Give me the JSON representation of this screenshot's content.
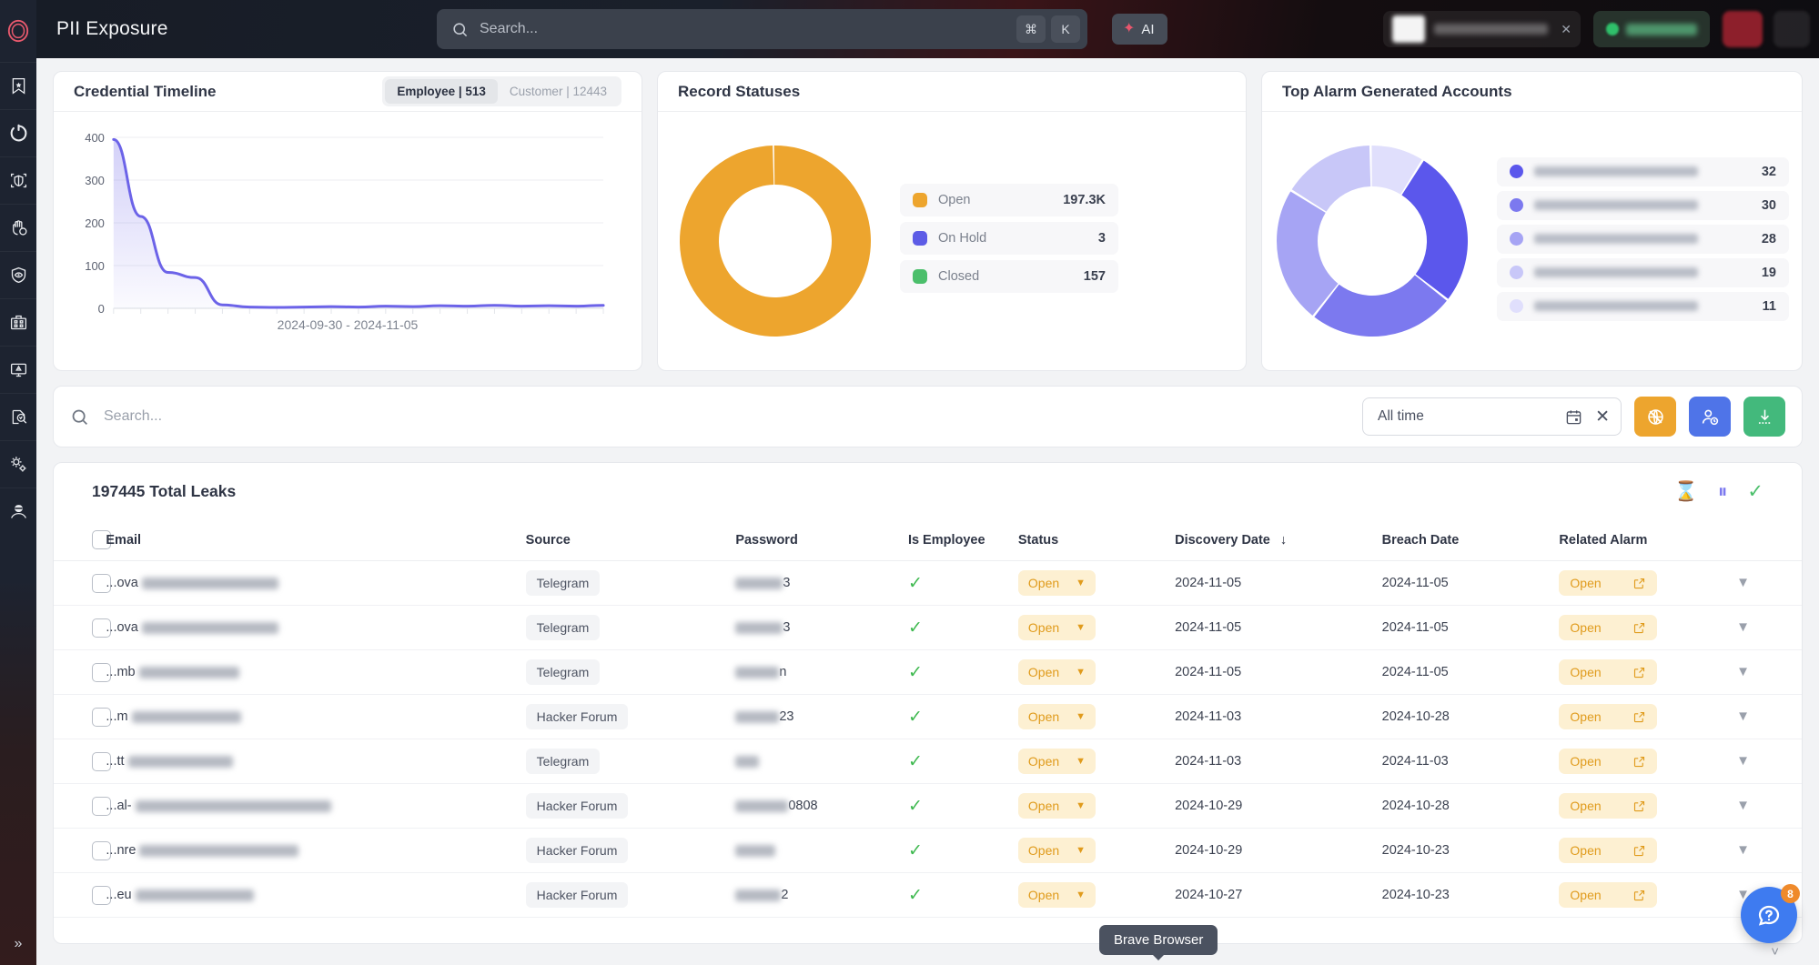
{
  "app": {
    "title": "PII Exposure",
    "logo_icon": "target-ring-icon"
  },
  "header": {
    "search": {
      "placeholder": "Search...",
      "value": "",
      "icon": "search-icon"
    },
    "shortcut_keys": [
      "⌘",
      "K"
    ],
    "ai_button": {
      "label": "AI",
      "icon": "sparkle-icon"
    },
    "account_chip": {
      "icon": "avatar-icon",
      "close_icon": "close-icon"
    },
    "status_pill": {
      "icon": "status-dot-icon"
    },
    "alert_button": {
      "icon": "alert-icon"
    },
    "menu_button": {
      "icon": "grid-icon"
    }
  },
  "sidebar": {
    "collapse_label": "»",
    "items": [
      {
        "name": "sidebar-item-bookmarks",
        "icon": "bookmark-star-icon"
      },
      {
        "name": "sidebar-item-refresh",
        "icon": "refresh-circle-icon"
      },
      {
        "name": "sidebar-item-shield-scan",
        "icon": "shield-scan-icon"
      },
      {
        "name": "sidebar-item-protection",
        "icon": "hand-shield-icon"
      },
      {
        "name": "sidebar-item-monitoring",
        "icon": "shield-eye-icon"
      },
      {
        "name": "sidebar-item-organization",
        "icon": "building-icon"
      },
      {
        "name": "sidebar-item-incidents",
        "icon": "monitor-warning-icon"
      },
      {
        "name": "sidebar-item-investigation",
        "icon": "document-search-icon"
      },
      {
        "name": "sidebar-item-settings",
        "icon": "gears-icon"
      },
      {
        "name": "sidebar-item-threat-actor",
        "icon": "hacker-icon"
      }
    ]
  },
  "cards": {
    "credential_timeline": {
      "title": "Credential Timeline",
      "tabs": [
        {
          "label": "Employee | 513",
          "active": true
        },
        {
          "label": "Customer | 12443",
          "active": false
        }
      ],
      "caption": "2024-09-30 - 2024-11-05"
    },
    "record_statuses": {
      "title": "Record Statuses",
      "legend": [
        {
          "label": "Open",
          "value": "197.3K",
          "color": "#eda52e"
        },
        {
          "label": "On Hold",
          "value": "3",
          "color": "#5d5ce6"
        },
        {
          "label": "Closed",
          "value": "157",
          "color": "#4bbf6b"
        }
      ]
    },
    "top_alarm_accounts": {
      "title": "Top Alarm Generated Accounts",
      "rows": [
        {
          "value": "32",
          "color": "#5b57ec"
        },
        {
          "value": "30",
          "color": "#7c79ef"
        },
        {
          "value": "28",
          "color": "#a6a4f4"
        },
        {
          "value": "19",
          "color": "#c8c7f8"
        },
        {
          "value": "11",
          "color": "#e0dffc"
        }
      ]
    }
  },
  "chart_data": [
    {
      "type": "area",
      "title": "Credential Timeline",
      "xlabel": "",
      "ylabel": "",
      "ylim": [
        0,
        400
      ],
      "yticks": [
        0,
        100,
        200,
        300,
        400
      ],
      "grid": true,
      "legend": "none",
      "x": [
        "2024-09-30",
        "2024-10-02",
        "2024-10-04",
        "2024-10-06",
        "2024-10-08",
        "2024-10-10",
        "2024-10-12",
        "2024-10-14",
        "2024-10-16",
        "2024-10-18",
        "2024-10-20",
        "2024-10-22",
        "2024-10-24",
        "2024-10-26",
        "2024-10-28",
        "2024-10-30",
        "2024-11-01",
        "2024-11-03",
        "2024-11-05"
      ],
      "series": [
        {
          "name": "Employee",
          "color": "#6c63e8",
          "values": [
            395,
            215,
            84,
            72,
            8,
            3,
            2,
            3,
            4,
            3,
            5,
            4,
            6,
            5,
            7,
            5,
            6,
            5,
            7
          ]
        }
      ],
      "caption": "2024-09-30 - 2024-11-05"
    },
    {
      "type": "pie",
      "title": "Record Statuses",
      "donut": true,
      "labels": [
        "Open",
        "On Hold",
        "Closed"
      ],
      "values": [
        197300,
        3,
        157
      ],
      "display_values": [
        "197.3K",
        "3",
        "157"
      ],
      "colors": [
        "#eda52e",
        "#5d5ce6",
        "#4bbf6b"
      ],
      "legend": "right"
    },
    {
      "type": "pie",
      "title": "Top Alarm Generated Accounts",
      "donut": true,
      "labels": [
        "account-1",
        "account-2",
        "account-3",
        "account-4",
        "account-5"
      ],
      "values": [
        32,
        30,
        28,
        19,
        11
      ],
      "colors": [
        "#5b57ec",
        "#7c79ef",
        "#a6a4f4",
        "#c8c7f8",
        "#e0dffc"
      ],
      "legend": "right"
    }
  ],
  "filterbar": {
    "search": {
      "placeholder": "Search...",
      "value": "",
      "icon": "search-icon"
    },
    "daterange": {
      "value": "All time",
      "calendar_icon": "calendar-icon",
      "clear_icon": "close-icon"
    },
    "buttons": [
      {
        "name": "globe-off-button",
        "icon": "globe-off-icon",
        "color": "#eda52e"
      },
      {
        "name": "assign-user-button",
        "icon": "user-clock-icon",
        "color": "#4f74e8"
      },
      {
        "name": "export-button",
        "icon": "download-icon",
        "color": "#43b97c"
      }
    ]
  },
  "table": {
    "total_label": "197445 Total Leaks",
    "actions": [
      {
        "name": "pending-filter",
        "icon": "hourglass-icon",
        "glyph": "⌛",
        "color": "#eda52e"
      },
      {
        "name": "onhold-filter",
        "icon": "pause-icon",
        "glyph": "⏸",
        "color": "#7c79ef"
      },
      {
        "name": "closed-filter",
        "icon": "check-icon",
        "glyph": "✓",
        "color": "#4bbf6b"
      }
    ],
    "columns": [
      "Email",
      "Source",
      "Password",
      "Is Employee",
      "Status",
      "Discovery Date",
      "Breach Date",
      "Related Alarm"
    ],
    "sorted_column": "Discovery Date",
    "sort_icon": "↓",
    "rows": [
      {
        "email_visible": "...ova",
        "email_blur_w": 150,
        "source": "Telegram",
        "pw_blur_w": 52,
        "pw_visible": "3",
        "is_employee": "✓",
        "status": "Open",
        "discovery": "2024-11-05",
        "breach": "2024-11-05",
        "alarm": "Open"
      },
      {
        "email_visible": "...ova",
        "email_blur_w": 150,
        "source": "Telegram",
        "pw_blur_w": 52,
        "pw_visible": "3",
        "is_employee": "✓",
        "status": "Open",
        "discovery": "2024-11-05",
        "breach": "2024-11-05",
        "alarm": "Open"
      },
      {
        "email_visible": "...mb",
        "email_blur_w": 110,
        "source": "Telegram",
        "pw_blur_w": 48,
        "pw_visible": "n",
        "is_employee": "✓",
        "status": "Open",
        "discovery": "2024-11-05",
        "breach": "2024-11-05",
        "alarm": "Open"
      },
      {
        "email_visible": "...m",
        "email_blur_w": 120,
        "source": "Hacker Forum",
        "pw_blur_w": 48,
        "pw_visible": "23",
        "is_employee": "✓",
        "status": "Open",
        "discovery": "2024-11-03",
        "breach": "2024-10-28",
        "alarm": "Open"
      },
      {
        "email_visible": "...tt",
        "email_blur_w": 115,
        "source": "Telegram",
        "pw_blur_w": 26,
        "pw_visible": "",
        "is_employee": "✓",
        "status": "Open",
        "discovery": "2024-11-03",
        "breach": "2024-11-03",
        "alarm": "Open"
      },
      {
        "email_visible": "...al-",
        "email_blur_w": 215,
        "source": "Hacker Forum",
        "pw_blur_w": 58,
        "pw_visible": "0808",
        "is_employee": "✓",
        "status": "Open",
        "discovery": "2024-10-29",
        "breach": "2024-10-28",
        "alarm": "Open"
      },
      {
        "email_visible": "...nre",
        "email_blur_w": 175,
        "source": "Hacker Forum",
        "pw_blur_w": 44,
        "pw_visible": "",
        "is_employee": "✓",
        "status": "Open",
        "discovery": "2024-10-29",
        "breach": "2024-10-23",
        "alarm": "Open"
      },
      {
        "email_visible": "...eu",
        "email_blur_w": 130,
        "source": "Hacker Forum",
        "pw_blur_w": 50,
        "pw_visible": "2",
        "is_employee": "✓",
        "status": "Open",
        "discovery": "2024-10-27",
        "breach": "2024-10-23",
        "alarm": "Open"
      }
    ]
  },
  "overlays": {
    "tooltip": "Brave Browser",
    "chat_fab": {
      "icon": "chat-icon",
      "badge": "8"
    }
  }
}
